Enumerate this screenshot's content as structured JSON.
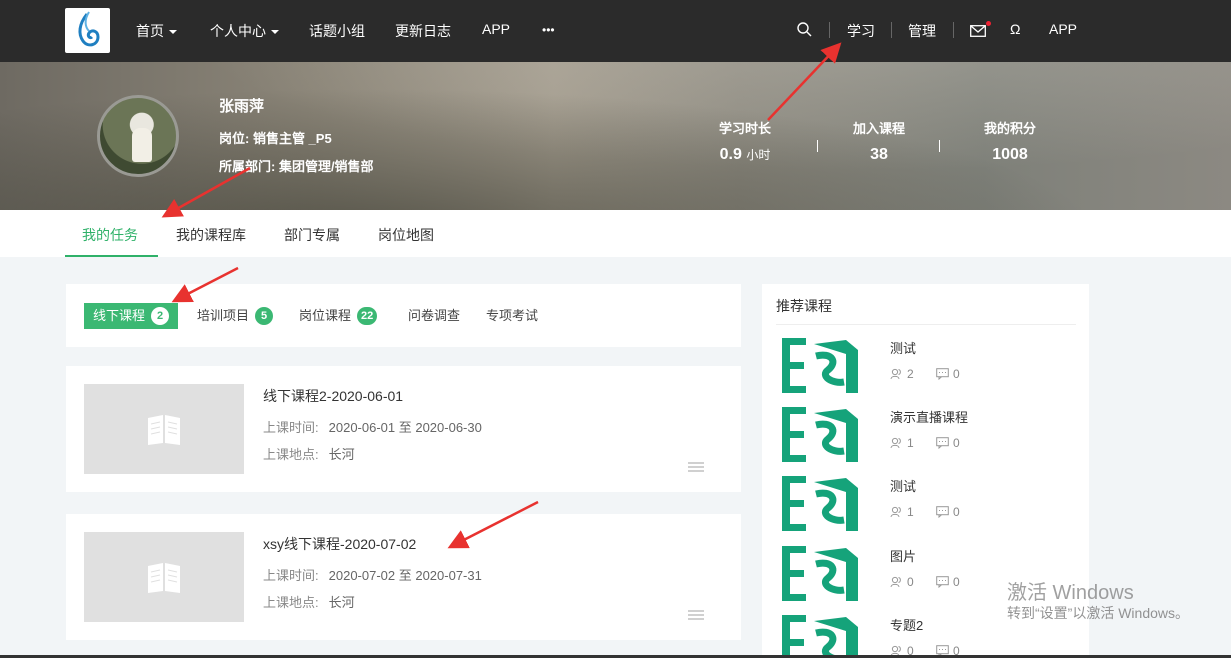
{
  "nav": {
    "items": [
      {
        "label": "首页",
        "dropdown": true
      },
      {
        "label": "个人中心",
        "dropdown": true
      },
      {
        "label": "话题小组"
      },
      {
        "label": "更新日志"
      },
      {
        "label": "APP"
      },
      {
        "label": "•••"
      }
    ],
    "right": {
      "search_icon": "search-icon",
      "study": "学习",
      "manage": "管理",
      "mail_icon": "mail-icon",
      "omega_icon": "Ω",
      "app": "APP"
    }
  },
  "profile": {
    "name": "张雨萍",
    "position": "岗位: 销售主管 _P5",
    "department": "所属部门: 集团管理/销售部"
  },
  "stats": [
    {
      "label": "学习时长",
      "value": "0.9",
      "unit": "小时"
    },
    {
      "label": "加入课程",
      "value": "38"
    },
    {
      "label": "我的积分",
      "value": "1008"
    }
  ],
  "tabs": [
    "我的任务",
    "我的课程库",
    "部门专属",
    "岗位地图"
  ],
  "filters": [
    {
      "label": "线下课程",
      "count": "2",
      "active": true
    },
    {
      "label": "培训项目",
      "count": "5"
    },
    {
      "label": "岗位课程",
      "count": "22"
    },
    {
      "label": "问卷调查"
    },
    {
      "label": "专项考试"
    }
  ],
  "courses": [
    {
      "title": "线下课程2-2020-06-01",
      "time_label": "上课时间:",
      "time": "2020-06-01 至 2020-06-30",
      "place_label": "上课地点:",
      "place": "长河"
    },
    {
      "title": "xsy线下课程-2020-07-02",
      "time_label": "上课时间:",
      "time": "2020-07-02 至 2020-07-31",
      "place_label": "上课地点:",
      "place": "长河"
    }
  ],
  "sidebar": {
    "title": "推荐课程",
    "items": [
      {
        "title": "测试",
        "students": "2",
        "comments": "0"
      },
      {
        "title": "演示直播课程",
        "students": "1",
        "comments": "0"
      },
      {
        "title": "测试",
        "students": "1",
        "comments": "0"
      },
      {
        "title": "图片",
        "students": "0",
        "comments": "0"
      },
      {
        "title": "专题2",
        "students": "0",
        "comments": "0"
      }
    ]
  },
  "watermark": {
    "line1": "激活 Windows",
    "line2": "转到“设置”以激活 Windows。"
  },
  "colors": {
    "accent": "#2fb169",
    "nav_bg": "#2b2b2b",
    "arrow": "#e8322f"
  }
}
